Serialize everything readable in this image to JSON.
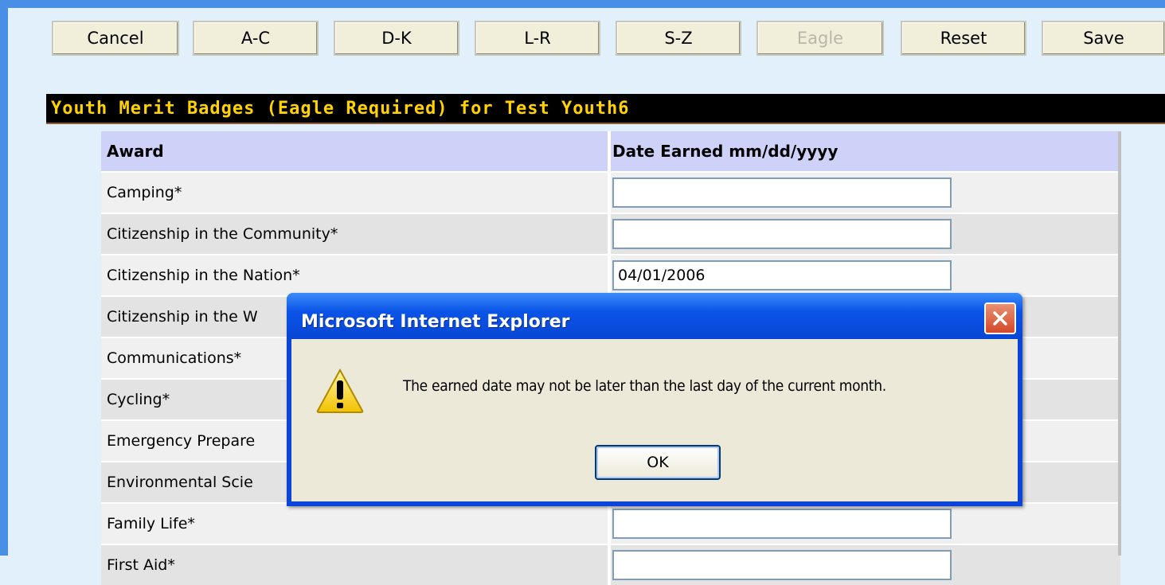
{
  "toolbar": {
    "buttons": [
      {
        "label": "Cancel",
        "disabled": false
      },
      {
        "label": "A-C",
        "disabled": false
      },
      {
        "label": "D-K",
        "disabled": false
      },
      {
        "label": "L-R",
        "disabled": false
      },
      {
        "label": "S-Z",
        "disabled": false
      },
      {
        "label": "Eagle",
        "disabled": true
      },
      {
        "label": "Reset",
        "disabled": false
      },
      {
        "label": "Save",
        "disabled": false
      }
    ]
  },
  "section": {
    "title": "Youth Merit Badges (Eagle Required) for Test Youth6"
  },
  "table": {
    "headers": {
      "award": "Award",
      "date": "Date Earned mm/dd/yyyy"
    },
    "rows": [
      {
        "award": "Camping*",
        "date": ""
      },
      {
        "award": "Citizenship in the Community*",
        "date": ""
      },
      {
        "award": "Citizenship in the Nation*",
        "date": "04/01/2006"
      },
      {
        "award": "Citizenship in the W",
        "date": ""
      },
      {
        "award": "Communications*",
        "date": ""
      },
      {
        "award": "Cycling*",
        "date": ""
      },
      {
        "award": "Emergency Prepare",
        "date": ""
      },
      {
        "award": "Environmental Scie",
        "date": ""
      },
      {
        "award": "Family Life*",
        "date": ""
      },
      {
        "award": "First Aid*",
        "date": ""
      }
    ]
  },
  "dialog": {
    "title": "Microsoft Internet Explorer",
    "message": "The earned date may not be later than the last day of the current month.",
    "ok_label": "OK",
    "icon": "warning-icon"
  },
  "colors": {
    "page_bg": "#e1f0fb",
    "frame_blue": "#4a8fe6",
    "title_bar_bg": "#000000",
    "title_text": "#ffd200",
    "header_row": "#cfd2f8",
    "dialog_titlebar": "#0a54e8"
  }
}
